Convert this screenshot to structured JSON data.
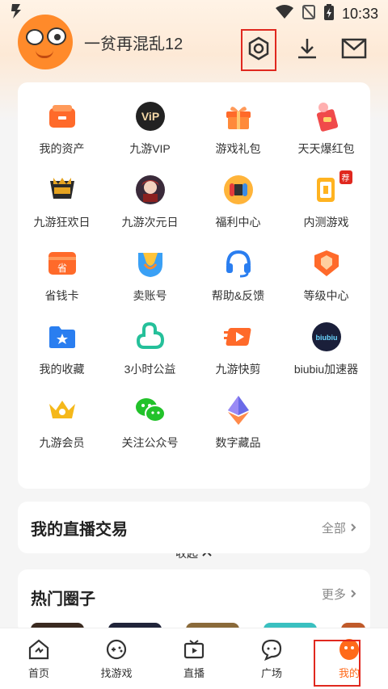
{
  "status": {
    "time": "10:33"
  },
  "profile": {
    "username": "一贫再混乱12"
  },
  "grid": [
    {
      "label": "我的资产",
      "icon": "wallet-icon"
    },
    {
      "label": "九游VIP",
      "icon": "vip-icon"
    },
    {
      "label": "游戏礼包",
      "icon": "gift-icon"
    },
    {
      "label": "天天爆红包",
      "icon": "red-packet-icon"
    },
    {
      "label": "九游狂欢日",
      "icon": "carnival-icon"
    },
    {
      "label": "九游次元日",
      "icon": "anime-icon"
    },
    {
      "label": "福利中心",
      "icon": "console-icon"
    },
    {
      "label": "内测游戏",
      "icon": "beta-icon",
      "badge": "荐"
    },
    {
      "label": "省钱卡",
      "icon": "card-icon"
    },
    {
      "label": "卖账号",
      "icon": "trade-icon"
    },
    {
      "label": "帮助&反馈",
      "icon": "headset-icon"
    },
    {
      "label": "等级中心",
      "icon": "level-icon"
    },
    {
      "label": "我的收藏",
      "icon": "folder-star-icon"
    },
    {
      "label": "3小时公益",
      "icon": "charity-icon"
    },
    {
      "label": "九游快剪",
      "icon": "video-edit-icon"
    },
    {
      "label": "biubiu加速器",
      "icon": "accelerator-icon"
    },
    {
      "label": "九游会员",
      "icon": "crown-icon"
    },
    {
      "label": "关注公众号",
      "icon": "wechat-icon"
    },
    {
      "label": "数字藏品",
      "icon": "ethereum-icon"
    }
  ],
  "collapse_label": "收起",
  "live": {
    "title": "我的直播交易",
    "more": "全部"
  },
  "circles": {
    "title": "热门圈子",
    "more": "更多"
  },
  "tabs": [
    {
      "label": "首页",
      "icon": "home-icon"
    },
    {
      "label": "找游戏",
      "icon": "gamepad-icon"
    },
    {
      "label": "直播",
      "icon": "tv-icon"
    },
    {
      "label": "广场",
      "icon": "chat-icon"
    },
    {
      "label": "我的",
      "icon": "profile-icon"
    }
  ],
  "colors": {
    "accent": "#ff6a1a",
    "highlight": "#e0281f"
  }
}
